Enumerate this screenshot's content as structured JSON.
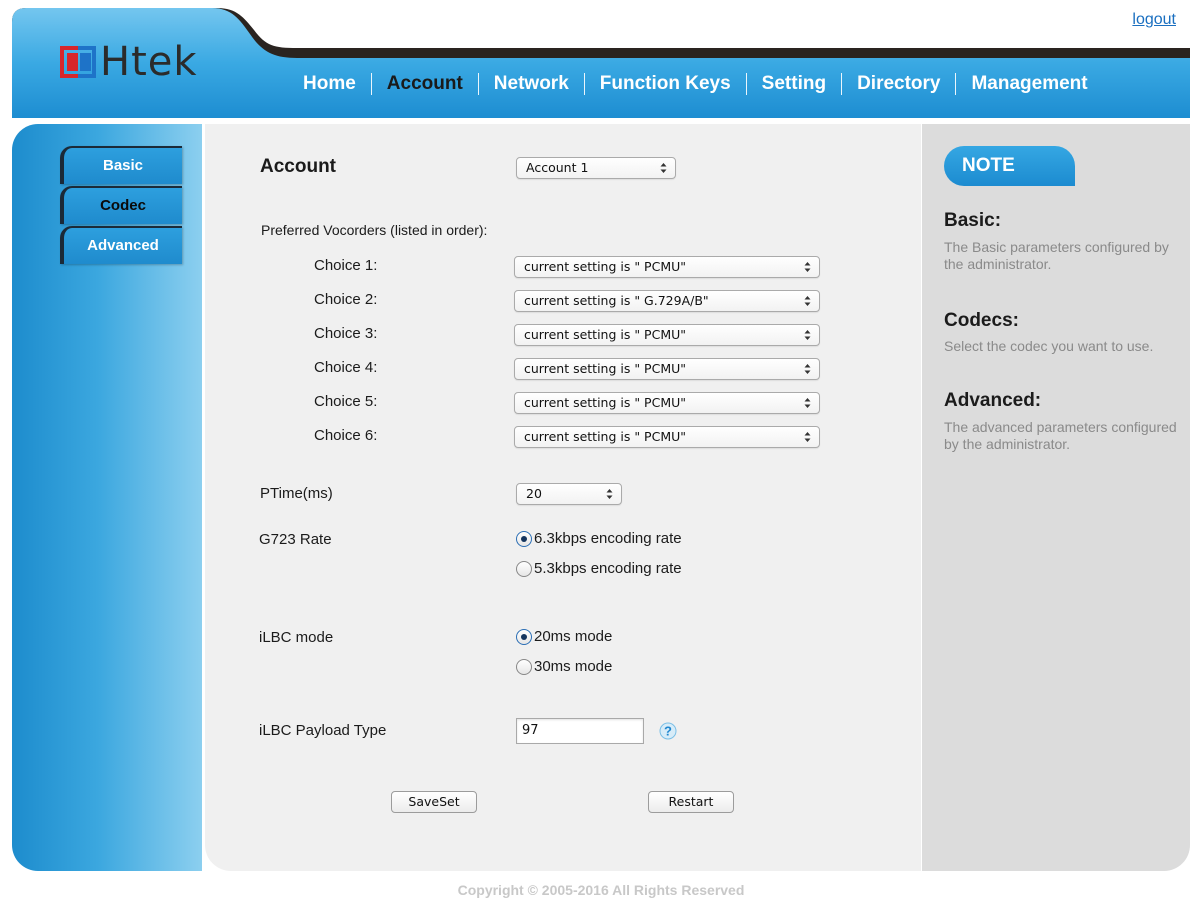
{
  "header": {
    "logo_text": "Htek",
    "logout": "logout",
    "nav": [
      {
        "label": "Home",
        "active": false
      },
      {
        "label": "Account",
        "active": true
      },
      {
        "label": "Network",
        "active": false
      },
      {
        "label": "Function Keys",
        "active": false
      },
      {
        "label": "Setting",
        "active": false
      },
      {
        "label": "Directory",
        "active": false
      },
      {
        "label": "Management",
        "active": false
      }
    ]
  },
  "sidebar": {
    "items": [
      {
        "label": "Basic",
        "active": false
      },
      {
        "label": "Codec",
        "active": true
      },
      {
        "label": "Advanced",
        "active": false
      }
    ]
  },
  "main": {
    "account_label": "Account",
    "account_select": "Account 1",
    "vocoders_label": "Preferred Vocorders (listed in order):",
    "choices": [
      {
        "label": "Choice 1:",
        "value": "current setting is \" PCMU\""
      },
      {
        "label": "Choice 2:",
        "value": "current setting is \" G.729A/B\""
      },
      {
        "label": "Choice 3:",
        "value": "current setting is \" PCMU\""
      },
      {
        "label": "Choice 4:",
        "value": "current setting is \" PCMU\""
      },
      {
        "label": "Choice 5:",
        "value": "current setting is \" PCMU\""
      },
      {
        "label": "Choice 6:",
        "value": "current setting is \" PCMU\""
      }
    ],
    "ptime_label": "PTime(ms)",
    "ptime_value": "20",
    "g723_label": "G723 Rate",
    "g723_options": [
      {
        "label": "6.3kbps encoding rate",
        "selected": true
      },
      {
        "label": "5.3kbps encoding rate",
        "selected": false
      }
    ],
    "ilbc_label": "iLBC mode",
    "ilbc_options": [
      {
        "label": "20ms mode",
        "selected": true
      },
      {
        "label": "30ms mode",
        "selected": false
      }
    ],
    "payload_label": "iLBC Payload Type",
    "payload_value": "97",
    "save_button": "SaveSet",
    "restart_button": "Restart"
  },
  "note": {
    "tag": "NOTE",
    "sections": [
      {
        "heading": "Basic:",
        "text": "The Basic parameters configured by the administrator."
      },
      {
        "heading": "Codecs:",
        "text": "Select the codec you want to use."
      },
      {
        "heading": "Advanced:",
        "text": "The advanced parameters configured by the administrator."
      }
    ]
  },
  "footer": {
    "copyright": "Copyright © 2005-2016 All Rights Reserved"
  },
  "colors": {
    "accent_blue": "#1e8fd2",
    "header_dark": "#2a2420",
    "note_bg": "#dcdcdc",
    "panel_bg": "#f0f0f0"
  }
}
